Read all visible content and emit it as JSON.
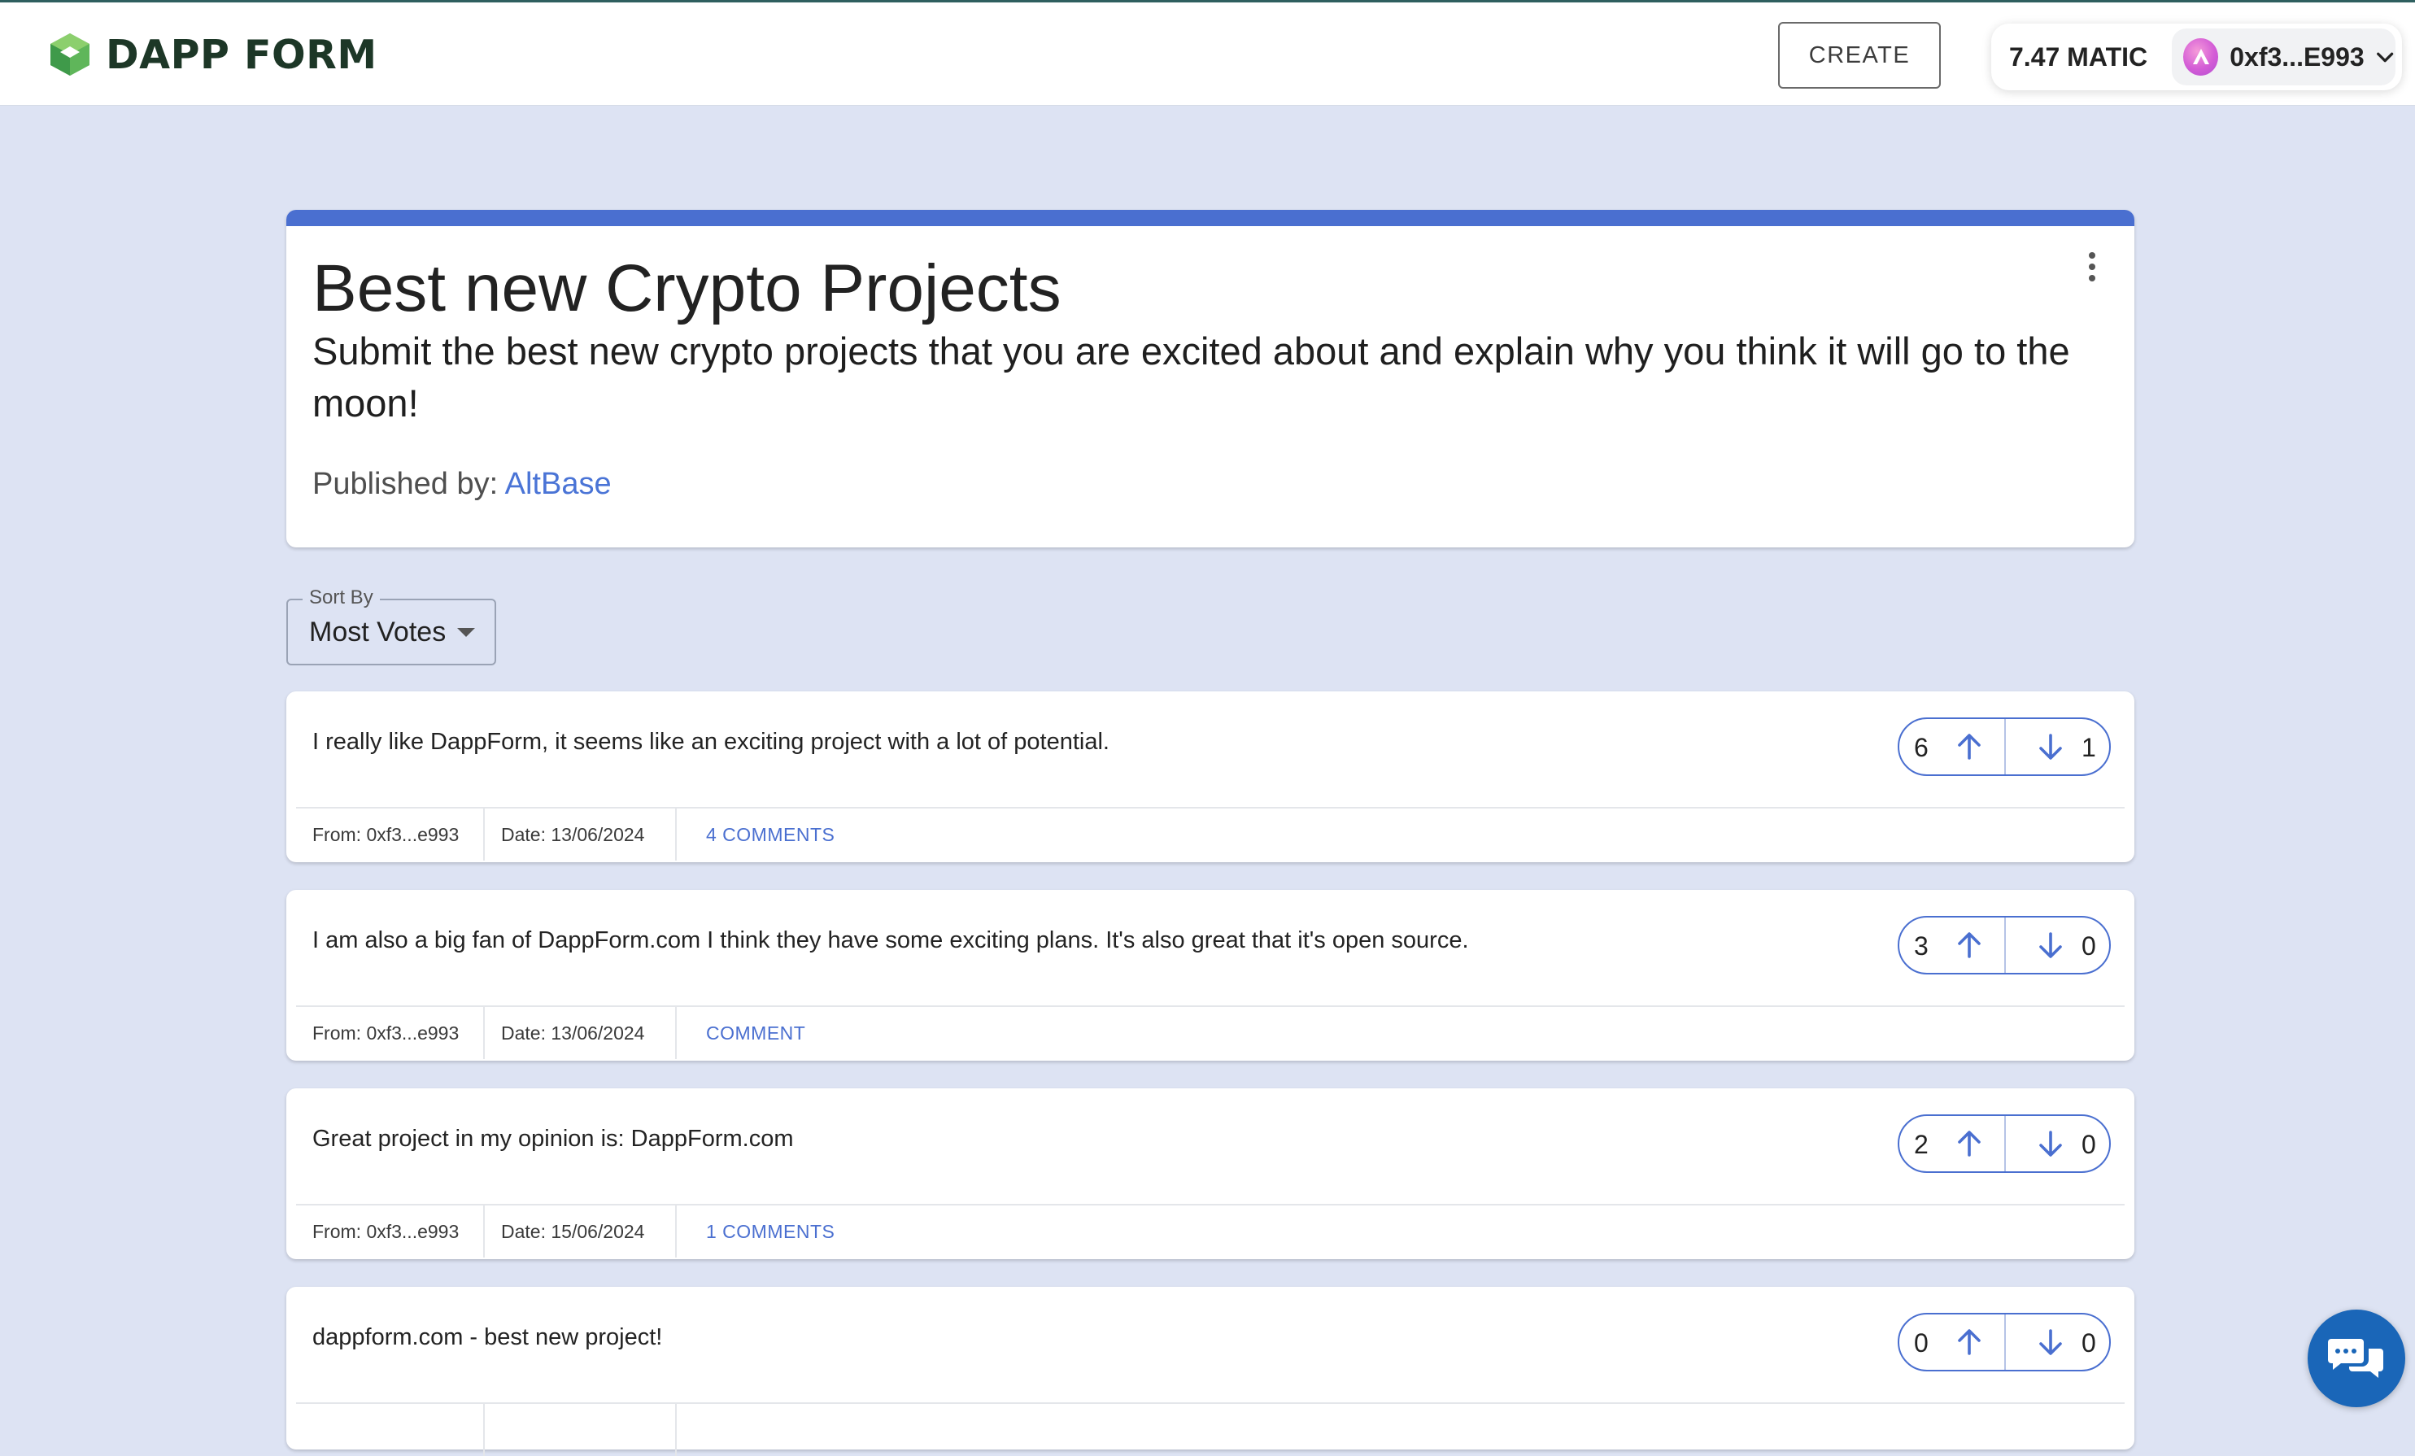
{
  "header": {
    "logo_text": "DAPP FORM",
    "create_label": "CREATE",
    "balance": "7.47 MATIC",
    "account_address": "0xf3...E993"
  },
  "form": {
    "title": "Best new Crypto Projects",
    "description": "Submit the best new crypto projects that you are excited about and explain why you think it will go to the moon!",
    "published_label": "Published by:",
    "author": "AltBase"
  },
  "sort": {
    "label": "Sort By",
    "value": "Most Votes"
  },
  "responses": [
    {
      "text": "I really like DappForm, it seems like an exciting project with a lot of potential.",
      "upvotes": "6",
      "downvotes": "1",
      "from": "From: 0xf3...e993",
      "date": "Date: 13/06/2024",
      "comments": "4 COMMENTS"
    },
    {
      "text": "I am also a big fan of DappForm.com I think they have some exciting plans. It's also great that it's open source.",
      "upvotes": "3",
      "downvotes": "0",
      "from": "From: 0xf3...e993",
      "date": "Date: 13/06/2024",
      "comments": "COMMENT"
    },
    {
      "text": "Great project in my opinion is: DappForm.com",
      "upvotes": "2",
      "downvotes": "0",
      "from": "From: 0xf3...e993",
      "date": "Date: 15/06/2024",
      "comments": "1 COMMENTS"
    },
    {
      "text": "dappform.com - best new project!",
      "upvotes": "0",
      "downvotes": "0"
    }
  ],
  "colors": {
    "accent": "#4a6fd0",
    "background": "#dde3f3",
    "logo_green": "#1d3727",
    "chat_blue": "#1a66b8"
  },
  "icons": {
    "logo": "hexagon-cube-icon",
    "account_avatar": "arbitrum-a-icon",
    "menu": "more-vertical-icon",
    "upvote": "arrow-up-icon",
    "downvote": "arrow-down-icon",
    "chat": "chat-bubbles-icon"
  }
}
